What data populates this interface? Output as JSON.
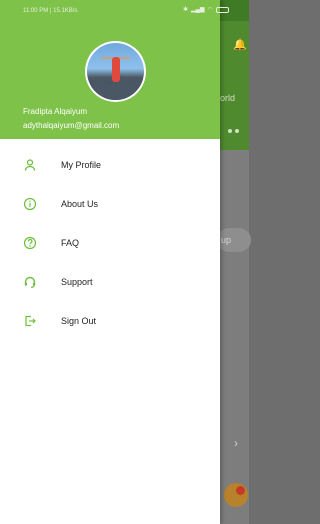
{
  "status_bar": {
    "time_and_speed": "11:00 PM | 15.1KB/s"
  },
  "drawer": {
    "user": {
      "name": "Fradipta Alqaiyum",
      "email": "adythalqaiyum@gmail.com"
    },
    "menu": [
      {
        "label": "My Profile",
        "icon": "person-icon"
      },
      {
        "label": "About Us",
        "icon": "info-icon"
      },
      {
        "label": "FAQ",
        "icon": "help-icon"
      },
      {
        "label": "Support",
        "icon": "headset-icon"
      },
      {
        "label": "Sign Out",
        "icon": "logout-icon"
      }
    ]
  },
  "background_app": {
    "world_text": "orld",
    "pill_text": "up"
  },
  "colors": {
    "drawer_header": "#7fc24a",
    "icon_accent": "#6cbf3c",
    "background_header": "#4f8a2f"
  }
}
